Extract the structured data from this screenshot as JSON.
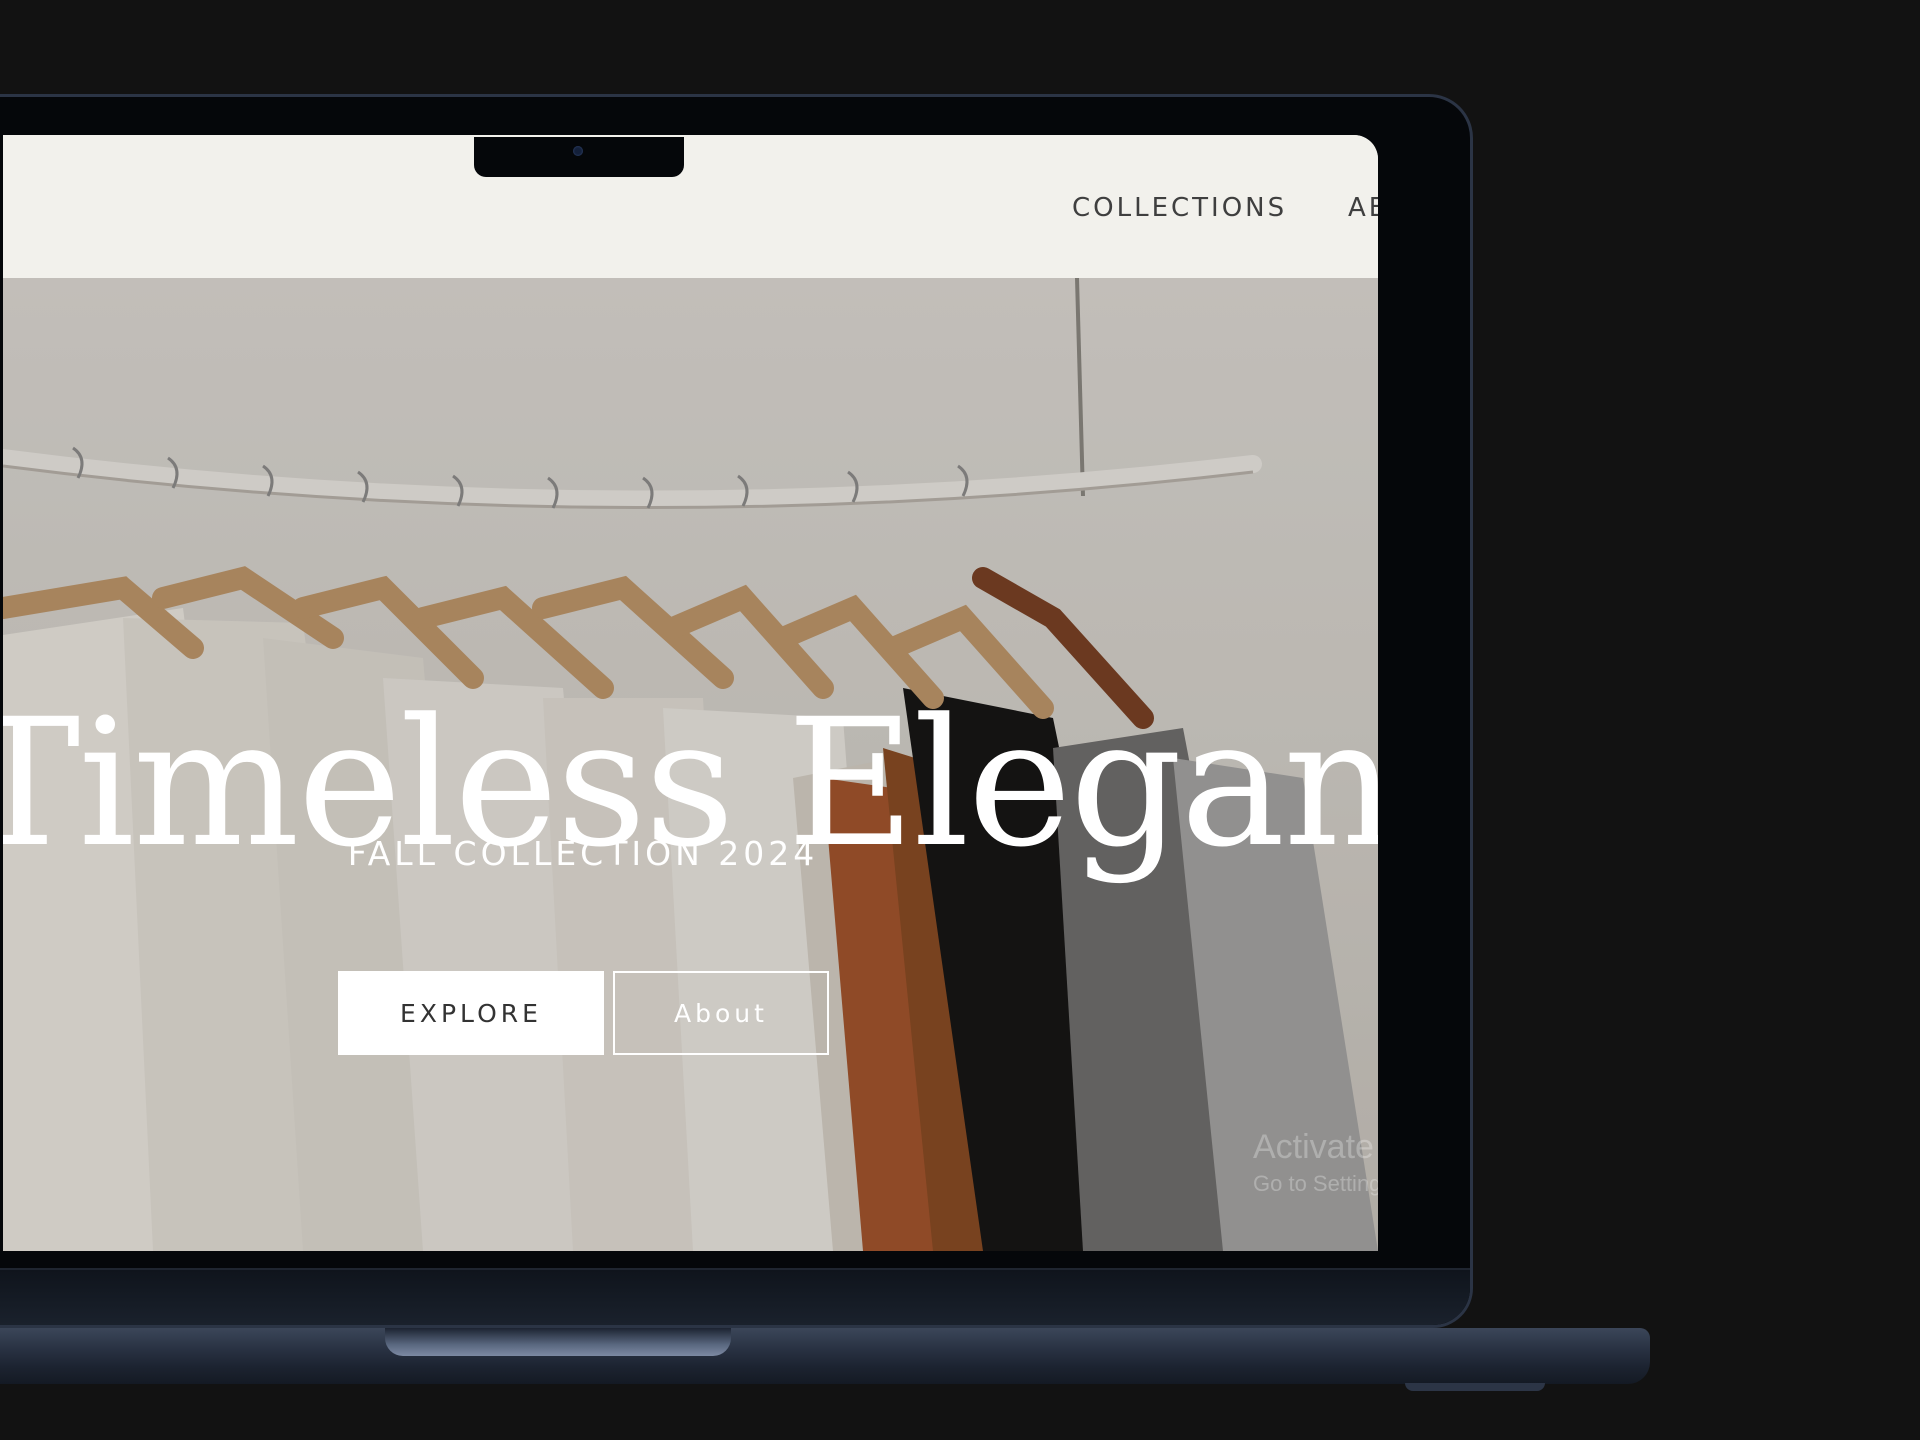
{
  "nav": {
    "items": [
      {
        "label": "COLLECTIONS"
      },
      {
        "label": "AB"
      }
    ]
  },
  "hero": {
    "title": "Timeless Elegance",
    "subtitle": "FALL COLLECTION 2024",
    "primary_button": "EXPLORE",
    "secondary_button": "About"
  },
  "os_watermark": {
    "line1": "Activate Windows",
    "line2": "Go to Settings to activate Windows."
  },
  "colors": {
    "page_background": "#121212",
    "header_background": "#f2f1ec",
    "nav_text": "#3f3f3f",
    "hero_text": "#ffffff",
    "laptop_frame": "#2b3445"
  }
}
